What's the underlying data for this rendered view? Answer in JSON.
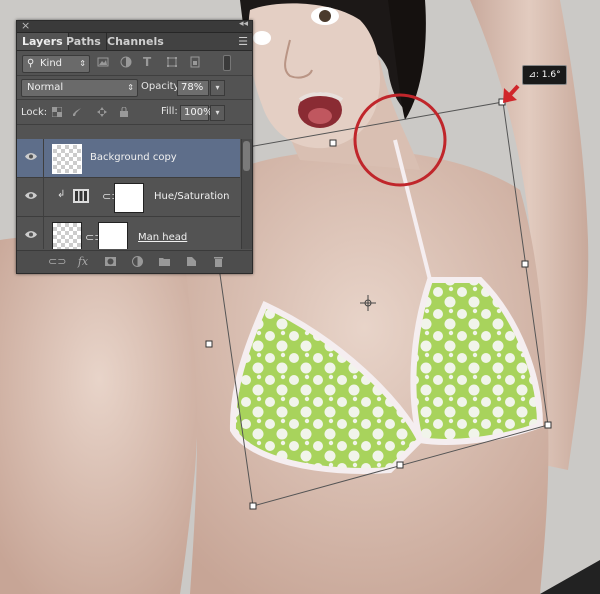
{
  "panel": {
    "tabs": [
      "Layers",
      "Paths",
      "Channels"
    ],
    "filter": {
      "kind_label": "Kind"
    },
    "blend_mode": "Normal",
    "opacity": {
      "label": "Opacity:",
      "value": "78%"
    },
    "lock": {
      "label": "Lock:"
    },
    "fill": {
      "label": "Fill:",
      "value": "100%"
    },
    "layers": [
      {
        "name": "Background copy",
        "selected": true
      },
      {
        "name": "Hue/Saturation",
        "selected": false
      },
      {
        "name": "Man head",
        "selected": false
      }
    ]
  },
  "transform": {
    "angle": "1.6°"
  },
  "colors": {
    "panel_bg": "#535353",
    "selected_layer": "#5e6e8a",
    "highlight_circle": "#c0262b",
    "arrow": "#d0262b",
    "bikini_green": "#a6d35a"
  },
  "icons": [
    "close-icon",
    "collapse-icon",
    "panel-menu-icon",
    "search-icon",
    "image-filter-icon",
    "adjustment-filter-icon",
    "type-filter-icon",
    "shape-filter-icon",
    "smart-object-filter-icon",
    "filter-toggle-icon",
    "lock-transparent-icon",
    "lock-brush-icon",
    "lock-position-icon",
    "lock-all-icon",
    "eye-icon",
    "chain-link-icon",
    "fx-icon",
    "mask-icon",
    "adjustment-icon",
    "folder-icon",
    "new-layer-icon",
    "trash-icon",
    "crosshair-icon",
    "red-arrow-icon"
  ]
}
